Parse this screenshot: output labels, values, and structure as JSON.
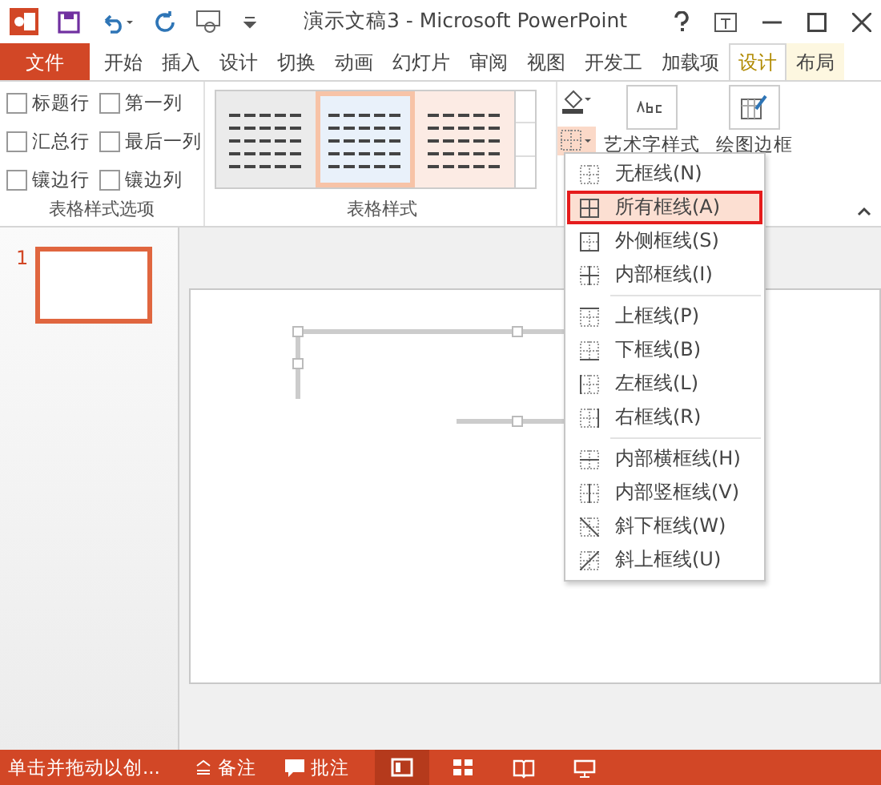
{
  "window": {
    "title": "演示文稿3 - Microsoft PowerPoint"
  },
  "tabs": [
    {
      "label": "文件",
      "kind": "file",
      "selected": false
    },
    {
      "label": "开始",
      "kind": "normal",
      "selected": false
    },
    {
      "label": "插入",
      "kind": "normal",
      "selected": false
    },
    {
      "label": "设计",
      "kind": "normal",
      "selected": false
    },
    {
      "label": "切换",
      "kind": "normal",
      "selected": false
    },
    {
      "label": "动画",
      "kind": "normal",
      "selected": false
    },
    {
      "label": "幻灯片",
      "kind": "normal",
      "selected": false
    },
    {
      "label": "审阅",
      "kind": "normal",
      "selected": false
    },
    {
      "label": "视图",
      "kind": "normal",
      "selected": false
    },
    {
      "label": "开发工",
      "kind": "normal",
      "selected": false
    },
    {
      "label": "加载项",
      "kind": "normal",
      "selected": false
    },
    {
      "label": "设计",
      "kind": "contextual",
      "selected": true
    },
    {
      "label": "布局",
      "kind": "contextual",
      "selected": false
    }
  ],
  "ribbon": {
    "options": {
      "checkboxes": [
        {
          "label": "标题行",
          "checked": false
        },
        {
          "label": "第一列",
          "checked": false
        },
        {
          "label": "汇总行",
          "checked": false
        },
        {
          "label": "最后一列",
          "checked": false
        },
        {
          "label": "镶边行",
          "checked": false
        },
        {
          "label": "镶边列",
          "checked": false
        }
      ],
      "label": "表格样式选项"
    },
    "styles": {
      "swatches": [
        {
          "color": "#ebebeb",
          "selected": false
        },
        {
          "color": "#e9f1fa",
          "selected": true
        },
        {
          "color": "#fcebe4",
          "selected": false
        }
      ],
      "label": "表格样式"
    },
    "art_text": {
      "label": "艺术字样式"
    },
    "draw_borders": {
      "label": "绘图边框"
    }
  },
  "border_menu": {
    "groups": [
      [
        {
          "label": "无框线(N)",
          "kind": "none",
          "selected": false
        },
        {
          "label": "所有框线(A)",
          "kind": "all",
          "selected": true
        },
        {
          "label": "外侧框线(S)",
          "kind": "outside",
          "selected": false
        },
        {
          "label": "内部框线(I)",
          "kind": "inside",
          "selected": false
        }
      ],
      [
        {
          "label": "上框线(P)",
          "kind": "top",
          "selected": false
        },
        {
          "label": "下框线(B)",
          "kind": "bottom",
          "selected": false
        },
        {
          "label": "左框线(L)",
          "kind": "left",
          "selected": false
        },
        {
          "label": "右框线(R)",
          "kind": "right",
          "selected": false
        }
      ],
      [
        {
          "label": "内部横框线(H)",
          "kind": "inside_h",
          "selected": false
        },
        {
          "label": "内部竖框线(V)",
          "kind": "inside_v",
          "selected": false
        },
        {
          "label": "斜下框线(W)",
          "kind": "diag_down",
          "selected": false
        },
        {
          "label": "斜上框线(U)",
          "kind": "diag_up",
          "selected": false
        }
      ]
    ]
  },
  "slides": [
    {
      "number": "1",
      "selected": true
    }
  ],
  "status_bar": {
    "hint": "单击并拖动以创...",
    "notes": "备注",
    "comments": "批注",
    "views": [
      {
        "kind": "normal",
        "selected": true
      },
      {
        "kind": "sorter",
        "selected": false
      },
      {
        "kind": "reading",
        "selected": false
      },
      {
        "kind": "slideshow",
        "selected": false
      }
    ]
  }
}
